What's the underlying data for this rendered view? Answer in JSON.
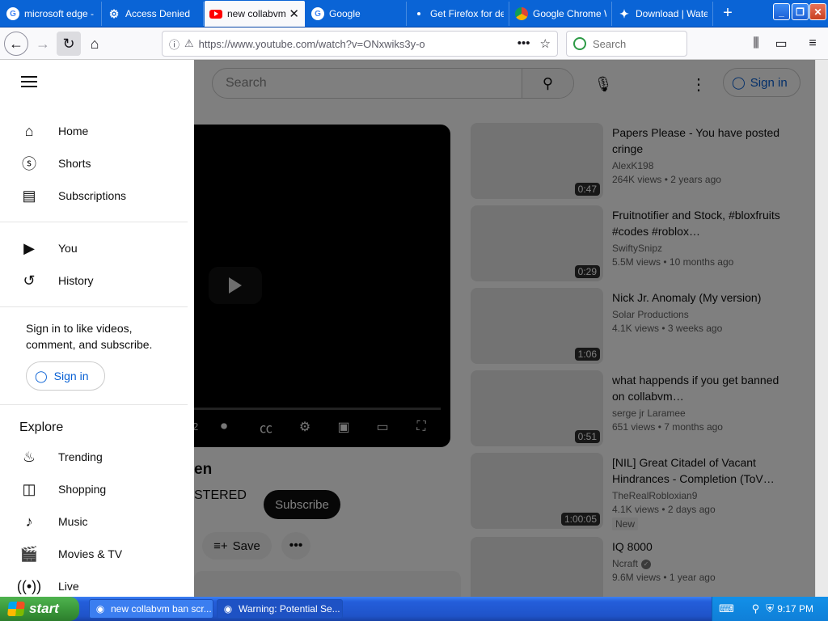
{
  "browser": {
    "tabs": [
      {
        "label": "microsoft edge - G",
        "favicon": "google-icon"
      },
      {
        "label": "Access Denied",
        "favicon": "access-denied-icon"
      },
      {
        "label": "new collabvm",
        "favicon": "youtube-icon",
        "active": true
      },
      {
        "label": "Google",
        "favicon": "google-icon"
      },
      {
        "label": "Get Firefox for de",
        "favicon": "firefox-icon"
      },
      {
        "label": "Google Chrome W",
        "favicon": "chrome-icon"
      },
      {
        "label": "Download | Wate",
        "favicon": "download-icon"
      }
    ],
    "url": "https://www.youtube.com/watch?v=ONxwiks3y-o",
    "search_placeholder": "Search"
  },
  "youtube": {
    "search_placeholder": "Search",
    "sign_in": "Sign in",
    "drawer": {
      "primary": [
        {
          "label": "Home",
          "icon": "home-icon"
        },
        {
          "label": "Shorts",
          "icon": "shorts-icon"
        },
        {
          "label": "Subscriptions",
          "icon": "subscriptions-icon"
        }
      ],
      "you": [
        {
          "label": "You",
          "icon": "you-icon"
        },
        {
          "label": "History",
          "icon": "history-icon"
        }
      ],
      "signin_prompt": "Sign in to like videos, comment, and subscribe.",
      "signin_button": "Sign in",
      "explore_heading": "Explore",
      "explore": [
        {
          "label": "Trending",
          "icon": "trending-icon"
        },
        {
          "label": "Shopping",
          "icon": "shopping-icon"
        },
        {
          "label": "Music",
          "icon": "music-icon"
        },
        {
          "label": "Movies & TV",
          "icon": "movies-icon"
        },
        {
          "label": "Live",
          "icon": "live-icon"
        }
      ]
    },
    "player": {
      "time_fragment": "2"
    },
    "video": {
      "title_fragment": "en",
      "channel_fragment": "STERED",
      "subscribe": "Subscribe",
      "save": "Save"
    },
    "related": [
      {
        "title": "Papers Please - You have posted cringe",
        "channel": "AlexK198",
        "views": "264K views",
        "age": "2 years ago",
        "duration": "0:47"
      },
      {
        "title": "Fruitnotifier and Stock, #bloxfruits #codes #roblox…",
        "channel": "SwiftySnipz",
        "views": "5.5M views",
        "age": "10 months ago",
        "duration": "0:29"
      },
      {
        "title": "Nick Jr. Anomaly (My version)",
        "channel": "Solar Productions",
        "views": "4.1K views",
        "age": "3 weeks ago",
        "duration": "1:06"
      },
      {
        "title": "what happends if you get banned on collabvm…",
        "channel": "serge jr Laramee",
        "views": "651 views",
        "age": "7 months ago",
        "duration": "0:51"
      },
      {
        "title": "[NIL] Great Citadel of Vacant Hindrances - Completion (ToV…",
        "channel": "TheRealRobloxian9",
        "views": "4.1K views",
        "age": "2 days ago",
        "duration": "1:00:05",
        "badge": "New"
      },
      {
        "title": "IQ 8000",
        "channel": "Ncraft",
        "views": "9.6M views",
        "age": "1 year ago",
        "verified": true
      }
    ]
  },
  "taskbar": {
    "start": "start",
    "items": [
      {
        "label": "new collabvm ban scr..."
      },
      {
        "label": "Warning: Potential Se..."
      }
    ],
    "clock": "9:17 PM"
  }
}
